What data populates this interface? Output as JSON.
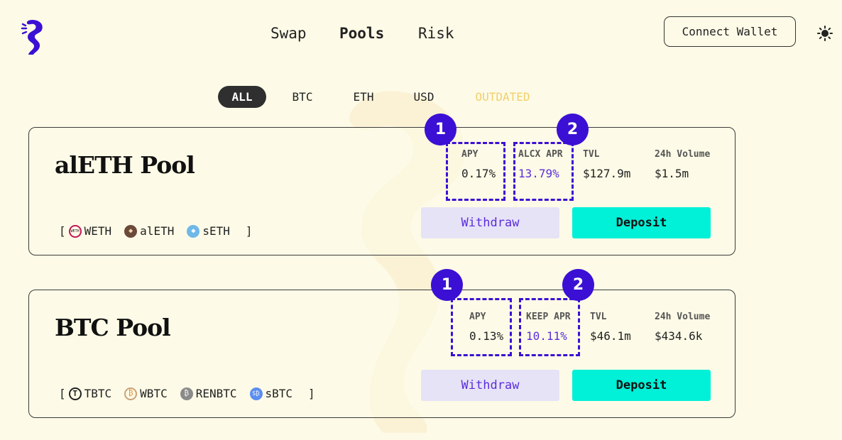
{
  "header": {
    "nav": [
      {
        "label": "Swap",
        "active": false
      },
      {
        "label": "Pools",
        "active": true
      },
      {
        "label": "Risk",
        "active": false
      }
    ],
    "connect_label": "Connect Wallet",
    "theme_icon": "sun-icon"
  },
  "filters": [
    "ALL",
    "BTC",
    "ETH",
    "USD",
    "OUTDATED"
  ],
  "pools": [
    {
      "title": "alETH Pool",
      "tokens": [
        "WETH",
        "alETH",
        "sETH"
      ],
      "stats": [
        {
          "label": "APY",
          "value": "0.17%"
        },
        {
          "label": "ALCX APR",
          "value": "13.79%"
        },
        {
          "label": "TVL",
          "value": "$127.9m"
        },
        {
          "label": "24h Volume",
          "value": "$1.5m"
        }
      ],
      "withdraw_label": "Withdraw",
      "deposit_label": "Deposit"
    },
    {
      "title": "BTC Pool",
      "tokens": [
        "TBTC",
        "WBTC",
        "RENBTC",
        "sBTC"
      ],
      "stats": [
        {
          "label": "APY",
          "value": "0.13%"
        },
        {
          "label": "KEEP APR",
          "value": "10.11%"
        },
        {
          "label": "TVL",
          "value": "$46.1m"
        },
        {
          "label": "24h Volume",
          "value": "$434.6k"
        }
      ],
      "withdraw_label": "Withdraw",
      "deposit_label": "Deposit"
    }
  ],
  "badges": [
    "1",
    "2"
  ],
  "colors": {
    "background": "#fdfbe7",
    "accent_purple": "#3b10d4",
    "deposit": "#00f0d8",
    "withdraw": "#e6e3f7",
    "outdated": "#f2cf6d"
  }
}
